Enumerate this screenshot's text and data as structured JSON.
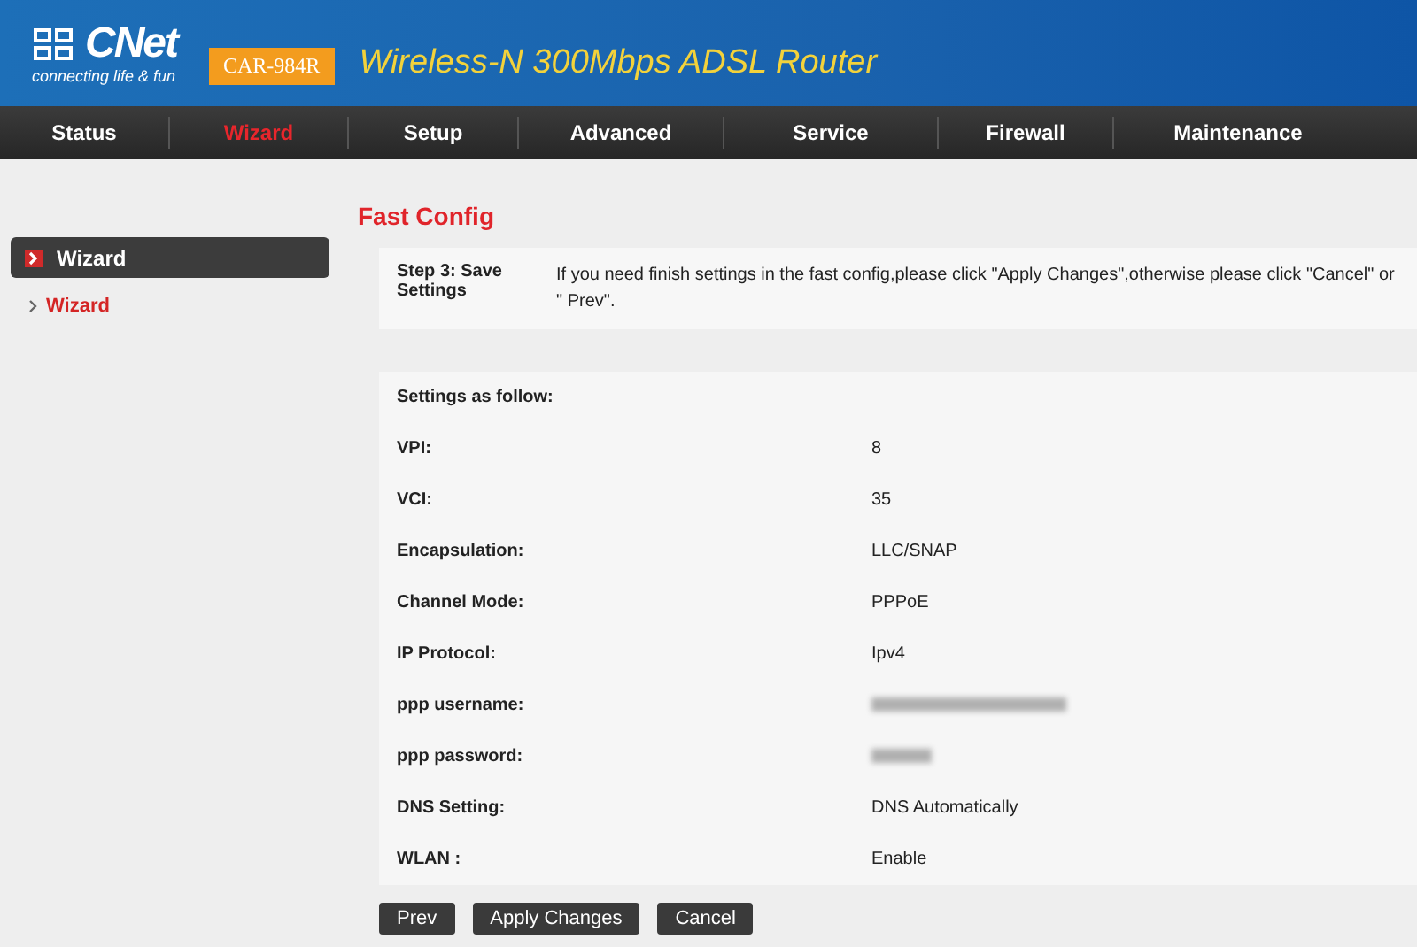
{
  "header": {
    "brand": "CNet",
    "tagline": "connecting life & fun",
    "model": "CAR-984R",
    "title": "Wireless-N 300Mbps ADSL Router"
  },
  "nav": [
    {
      "label": "Status",
      "selected": false
    },
    {
      "label": "Wizard",
      "selected": true
    },
    {
      "label": "Setup",
      "selected": false
    },
    {
      "label": "Advanced",
      "selected": false
    },
    {
      "label": "Service",
      "selected": false
    },
    {
      "label": "Firewall",
      "selected": false
    },
    {
      "label": "Maintenance",
      "selected": false
    }
  ],
  "sidebar": {
    "heading": "Wizard",
    "items": [
      {
        "label": "Wizard",
        "selected": true
      }
    ]
  },
  "page_title": "Fast Config",
  "step": {
    "label": "Step 3: Save Settings",
    "text": "If you need finish settings in the fast config,please click \"Apply Changes\",otherwise please click \"Cancel\" or \" Prev\"."
  },
  "settings_heading": "Settings as follow:",
  "settings": [
    {
      "label": "VPI:",
      "kind": "text",
      "value": "8"
    },
    {
      "label": "VCI:",
      "kind": "text",
      "value": "35"
    },
    {
      "label": "Encapsulation:",
      "kind": "text",
      "value": "LLC/SNAP"
    },
    {
      "label": "Channel Mode:",
      "kind": "text",
      "value": "PPPoE"
    },
    {
      "label": "IP Protocol:",
      "kind": "text",
      "value": "Ipv4"
    },
    {
      "label": "ppp username:",
      "kind": "blurred"
    },
    {
      "label": "ppp password:",
      "kind": "blurred_short"
    },
    {
      "label": "DNS Setting:",
      "kind": "text",
      "value": "DNS Automatically"
    },
    {
      "label": "WLAN :",
      "kind": "text",
      "value": "Enable"
    }
  ],
  "buttons": [
    "Prev",
    "Apply Changes",
    "Cancel"
  ]
}
